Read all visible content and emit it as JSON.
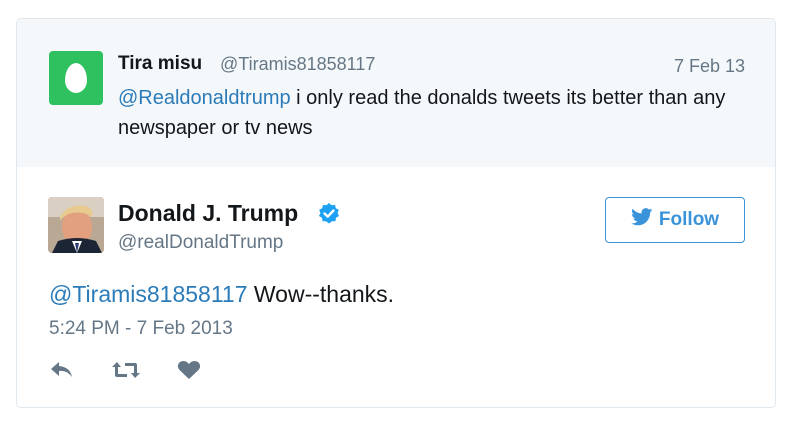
{
  "parent_tweet": {
    "name": "Tira misu",
    "handle": "@Tiramis81858117",
    "date": "7 Feb 13",
    "mention": "@Realdonaldtrump",
    "text": " i only read the donalds tweets its better than any newspaper or tv news",
    "avatar_color": "#2fc15f"
  },
  "main_tweet": {
    "name": "Donald J. Trump",
    "handle": "@realDonaldTrump",
    "verified": true,
    "mention": "@Tiramis81858117",
    "text": " Wow--thanks.",
    "timestamp": "5:24 PM - 7 Feb 2013"
  },
  "follow_button": {
    "label": "Follow",
    "icon": "twitter-bird-icon"
  },
  "actions": [
    {
      "icon": "reply-icon"
    },
    {
      "icon": "retweet-icon"
    },
    {
      "icon": "heart-icon"
    }
  ],
  "colors": {
    "link": "#2b7bb9",
    "accent": "#3b94d9",
    "muted": "#657786",
    "parent_bg": "#f5f8fa"
  }
}
